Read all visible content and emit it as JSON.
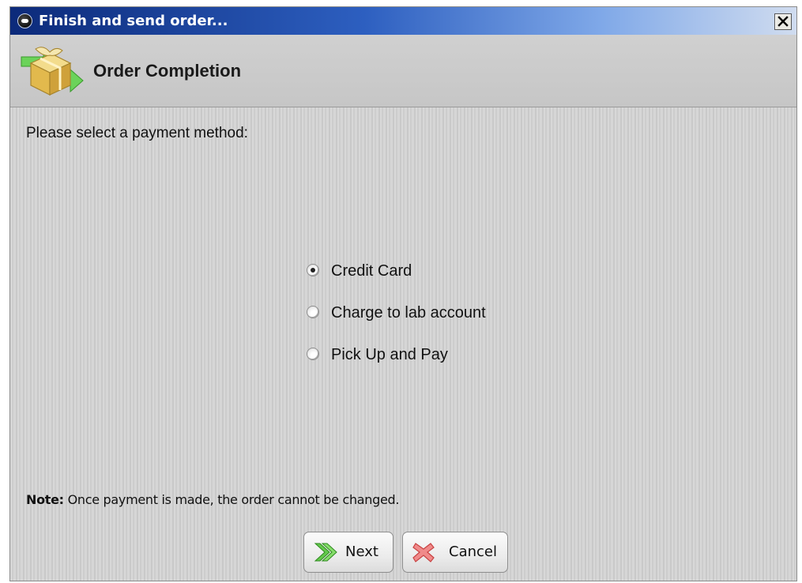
{
  "window": {
    "title": "Finish and send order...",
    "close_symbol": "close-icon"
  },
  "header": {
    "title": "Order Completion",
    "icon": "package-icon"
  },
  "main": {
    "prompt": "Please select a payment method:",
    "payment_options": [
      {
        "label": "Credit Card",
        "selected": true
      },
      {
        "label": "Charge to lab account",
        "selected": false
      },
      {
        "label": "Pick Up and Pay",
        "selected": false
      }
    ],
    "note_label": "Note:",
    "note_text": " Once payment is made, the order cannot be changed."
  },
  "buttons": {
    "next_label": "Next",
    "next_icon": "double-chevron-right-icon",
    "cancel_label": "Cancel",
    "cancel_icon": "cancel-x-icon"
  },
  "colors": {
    "titlebar_start": "#0c2a7a",
    "titlebar_end": "#d0dcef",
    "window_background": "#d4d4d4",
    "next_icon_green": "#3aa829",
    "cancel_icon_red": "#e35b5b"
  }
}
